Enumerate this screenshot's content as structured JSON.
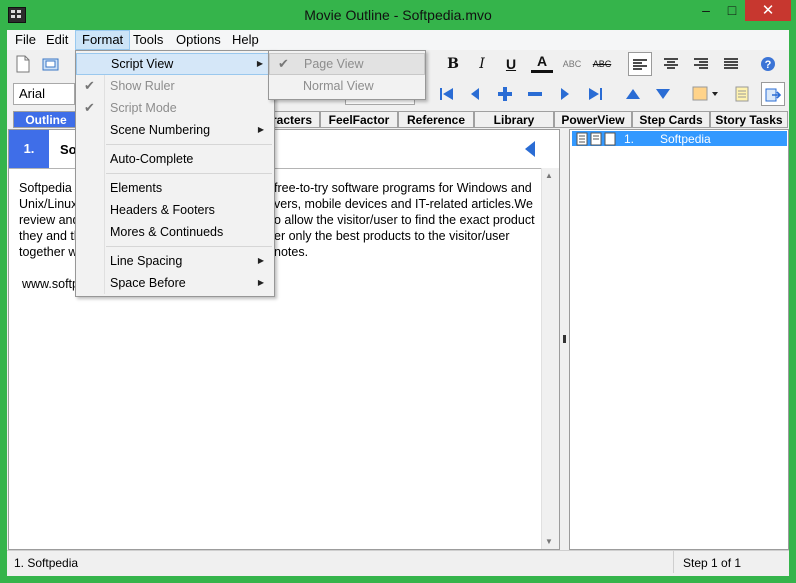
{
  "window": {
    "title": "Movie Outline - Softpedia.mvo",
    "minimize": "–",
    "maximize": "□",
    "close": "✕"
  },
  "menubar": {
    "items": [
      "File",
      "Edit",
      "Format",
      "Tools",
      "Options",
      "Help"
    ]
  },
  "toolbar": {
    "font": "Arial",
    "bold": "B",
    "italic": "I",
    "underline": "U",
    "text_color": "A",
    "spell": "ABC",
    "strike": "ABC"
  },
  "tabs": [
    "Outline",
    "racters",
    "FeelFactor",
    "Reference",
    "Library",
    "PowerView",
    "Step Cards",
    "Story Tasks"
  ],
  "scene": {
    "number": "1.",
    "title_visible": "So"
  },
  "document": {
    "lines_left": [
      "Softpedia",
      "Unix/Linux",
      "review and",
      "they and th",
      "together w"
    ],
    "lines_right": [
      "free-to-try software programs for Windows and",
      "vers, mobile devices and IT-related articles.We",
      "o allow the visitor/user to find the exact product",
      "er only the best products to the visitor/user",
      "notes."
    ],
    "url_fragment": "www.softp"
  },
  "outline_list": [
    {
      "number": "1.",
      "title": "Softpedia"
    }
  ],
  "format_menu": {
    "items": [
      {
        "label": "Script View",
        "state": "highlighted",
        "submenu": true
      },
      {
        "label": "Show Ruler",
        "state": "disabled",
        "checked": true
      },
      {
        "label": "Script Mode",
        "state": "disabled",
        "checked": true
      },
      {
        "label": "Scene Numbering",
        "submenu": true
      },
      {
        "label": "Auto-Complete"
      },
      {
        "label": "Elements"
      },
      {
        "label": "Headers & Footers"
      },
      {
        "label": "Mores & Continueds"
      },
      {
        "label": "Line Spacing",
        "submenu": true
      },
      {
        "label": "Space Before",
        "submenu": true
      }
    ]
  },
  "script_view_submenu": {
    "items": [
      {
        "label": "Page View",
        "checked": true,
        "state": "highlighted-disabled"
      },
      {
        "label": "Normal View",
        "state": "disabled"
      }
    ]
  },
  "status": {
    "left": "1.  Softpedia",
    "right": "Step 1 of 1"
  },
  "colors": {
    "accent": "#3f6ee8",
    "title_bar": "#35b44b",
    "selection": "#3399ff",
    "close": "#c7372f"
  }
}
